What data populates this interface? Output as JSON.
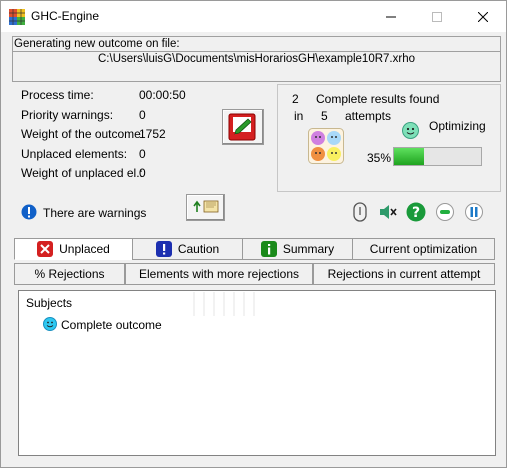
{
  "window": {
    "title": "GHC-Engine"
  },
  "file": {
    "label": "Generating new outcome on file:",
    "path": "C:\\Users\\luisG\\Documents\\misHorariosGH\\example10R7.xrho"
  },
  "stats": [
    {
      "label": "Process time:",
      "value": "00:00:50"
    },
    {
      "label": "Priority warnings:",
      "value": "0"
    },
    {
      "label": "Weight of the outcome:",
      "value": "1752"
    },
    {
      "label": "Unplaced elements:",
      "value": "0"
    },
    {
      "label": "Weight of unplaced el.:",
      "value": "0"
    }
  ],
  "results": {
    "count": "2",
    "count_label": "Complete results found",
    "in_label": "in",
    "attempts": "5",
    "attempts_label": "attempts",
    "status": "Optimizing",
    "progress_text": "35%",
    "progress_fraction": 0.35
  },
  "warning": {
    "text": "There are warnings"
  },
  "tabs_row1": [
    {
      "label": "Unplaced",
      "icon": "x-red-icon"
    },
    {
      "label": "Caution",
      "icon": "exclamation-blue-icon"
    },
    {
      "label": "Summary",
      "icon": "info-green-icon"
    },
    {
      "label": "Current optimization"
    }
  ],
  "tabs_row2": [
    {
      "label": "% Rejections"
    },
    {
      "label": "Elements with more rejections"
    },
    {
      "label": "Rejections in current attempt"
    }
  ],
  "content": {
    "header": "Subjects",
    "items": [
      {
        "label": "Complete outcome",
        "icon": "smiley-face-icon"
      }
    ]
  },
  "colors": {
    "progress": "#2fbf2f",
    "accent_blue": "#1060c8",
    "error_red": "#d42020"
  }
}
